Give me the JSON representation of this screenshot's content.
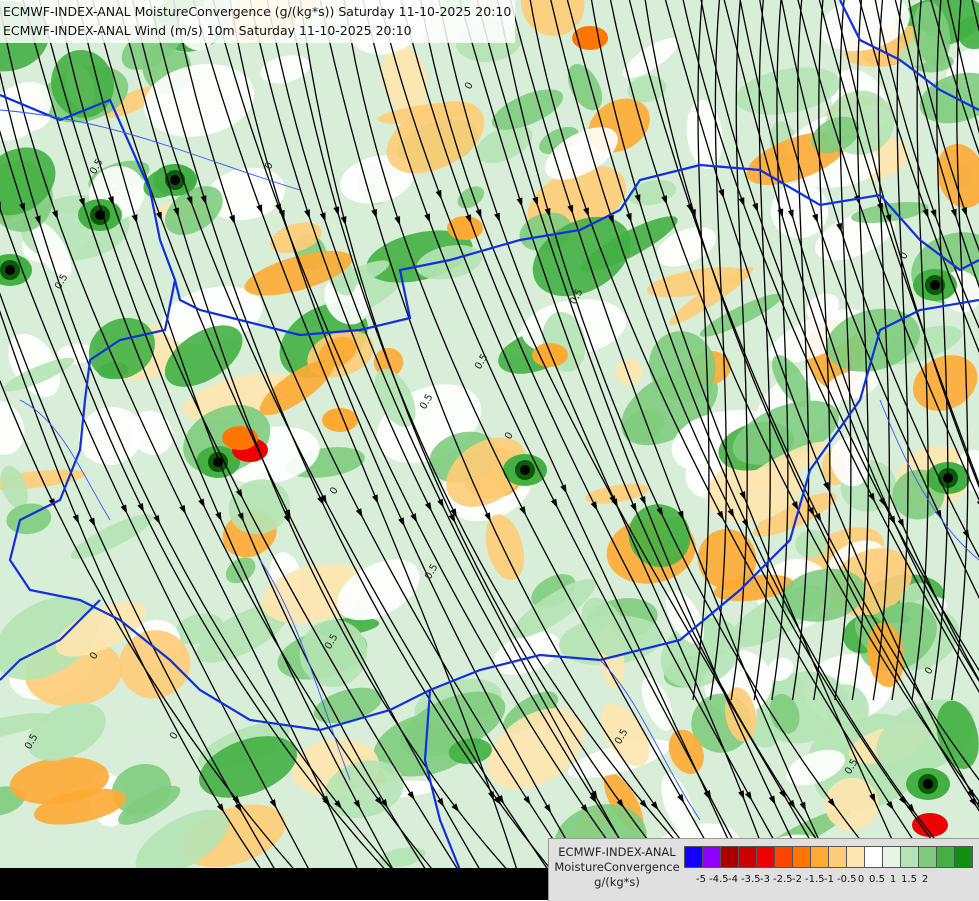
{
  "header": {
    "line1": "ECMWF-INDEX-ANAL MoistureConvergence (g/(kg*s)) Saturday 11-10-2025 20:10",
    "line2": "ECMWF-INDEX-ANAL Wind (m/s) 10m Saturday 11-10-2025 20:10"
  },
  "legend": {
    "model": "ECMWF-INDEX-ANAL",
    "variable": "MoistureConvergence",
    "unit": "g/(kg*s)",
    "colors": [
      "#1400ff",
      "#8c00ff",
      "#aa0000",
      "#cc0000",
      "#ee0000",
      "#ff4400",
      "#ff7700",
      "#ffaa33",
      "#ffcc77",
      "#ffe5b0",
      "#ffffff",
      "#e6f5e6",
      "#b5e3b5",
      "#7fcc7f",
      "#44b044",
      "#109010"
    ],
    "ticks": [
      "-5",
      "-4.5",
      "-4",
      "-3.5",
      "-3",
      "-2.5",
      "-2",
      "-1.5",
      "-1",
      "-0.5",
      "0",
      "0.5",
      "1",
      "1.5",
      "2"
    ]
  },
  "map": {
    "contour_labels": [
      "0.5",
      "0",
      "0.5",
      "0",
      "0.5",
      "0",
      "0.5",
      "0.5",
      "0",
      "0.5",
      "0",
      "0.5",
      "0",
      "0.5",
      "0.5",
      "0",
      "0.5",
      "0"
    ],
    "colors": {
      "border": "#1030dd",
      "river": "#3355ff",
      "streamline": "#000000",
      "contour": "#222222"
    }
  }
}
